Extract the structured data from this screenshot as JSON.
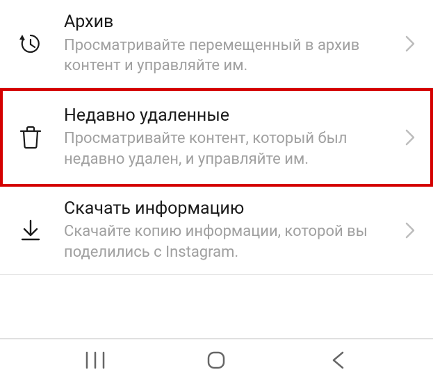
{
  "items": [
    {
      "title": "Архив",
      "subtitle": "Просматривайте перемещенный в архив контент и управляйте им."
    },
    {
      "title": "Недавно удаленные",
      "subtitle": "Просматривайте контент, который был недавно удален, и управляйте им."
    },
    {
      "title": "Скачать информацию",
      "subtitle": "Скачайте копию информации, которой вы поделились с Instagram."
    }
  ]
}
